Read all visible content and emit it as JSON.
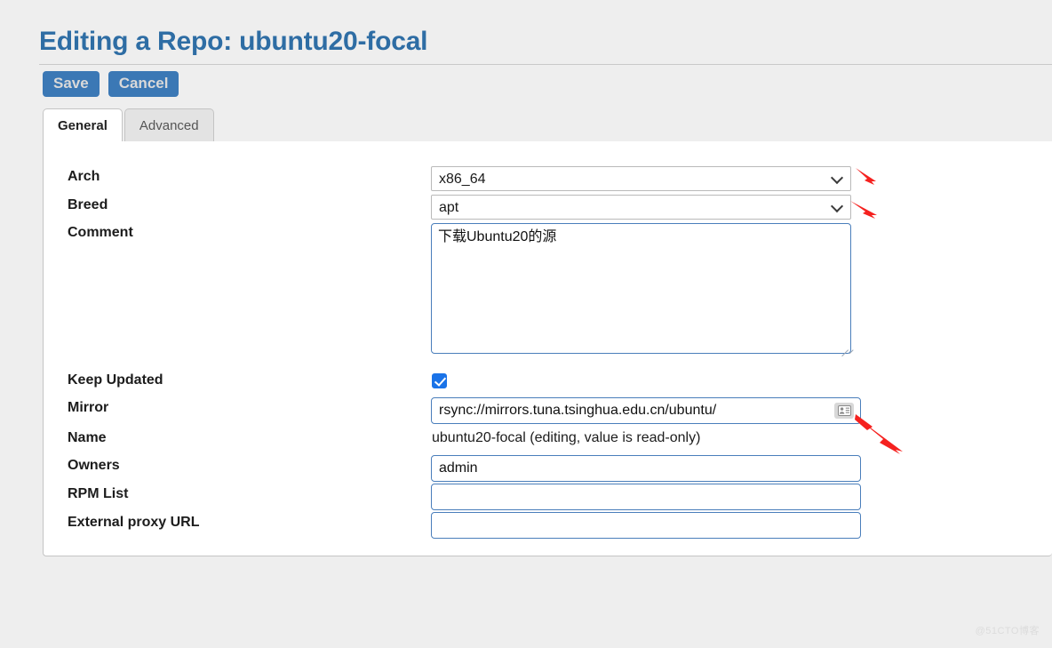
{
  "page": {
    "title": "Editing a Repo: ubuntu20-focal",
    "title_color": "#2e6da4",
    "background_color": "#eeeeee"
  },
  "toolbar": {
    "save_label": "Save",
    "cancel_label": "Cancel",
    "button_color": "#3b78b5"
  },
  "tabs": [
    {
      "label": "General",
      "active": true
    },
    {
      "label": "Advanced",
      "active": false
    }
  ],
  "form": {
    "fields": [
      {
        "label": "Arch",
        "type": "select",
        "value": "x86_64",
        "options": [
          "x86_64"
        ]
      },
      {
        "label": "Breed",
        "type": "select",
        "value": "apt",
        "options": [
          "apt"
        ]
      },
      {
        "label": "Comment",
        "type": "textarea",
        "value": "下载Ubuntu20的源"
      },
      {
        "label": "Keep Updated",
        "type": "checkbox",
        "checked": true
      },
      {
        "label": "Mirror",
        "type": "text",
        "value": "rsync://mirrors.tuna.tsinghua.edu.cn/ubuntu/",
        "icon": "contact-card-autofill-icon"
      },
      {
        "label": "Name",
        "type": "readonly-text",
        "value": "ubuntu20-focal (editing, value is read-only)"
      },
      {
        "label": "Owners",
        "type": "text",
        "value": "admin"
      },
      {
        "label": "RPM List",
        "type": "text",
        "value": ""
      },
      {
        "label": "External proxy URL",
        "type": "text",
        "value": ""
      }
    ]
  },
  "annotations": {
    "arrow_color": "#f5211f",
    "arrows": [
      {
        "name": "arrow-pointing-arch-select"
      },
      {
        "name": "arrow-pointing-breed-select"
      },
      {
        "name": "arrow-pointing-mirror-input"
      }
    ]
  },
  "watermark": {
    "text": "@51CTO博客"
  }
}
